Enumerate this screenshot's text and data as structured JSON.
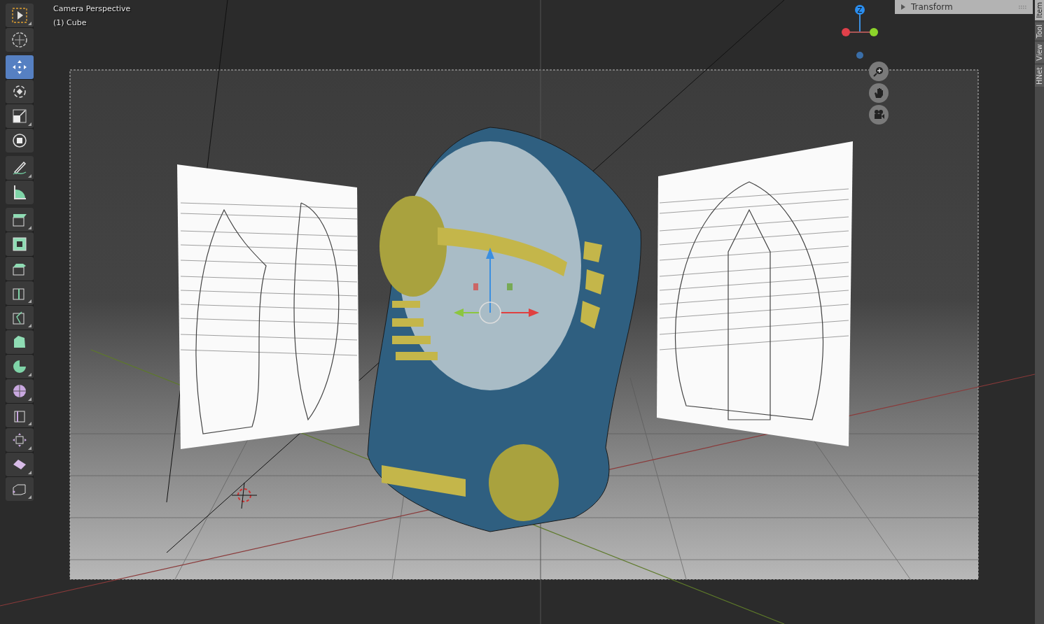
{
  "viewport": {
    "view_name": "Camera Perspective",
    "object_name": "(1) Cube"
  },
  "toolbar": [
    {
      "tools": [
        {
          "kind": "select-box",
          "selected": false,
          "has_submenu": true
        },
        {
          "kind": "cursor",
          "selected": false,
          "has_submenu": false
        }
      ]
    },
    {
      "tools": [
        {
          "kind": "move",
          "selected": true,
          "has_submenu": false
        },
        {
          "kind": "rotate",
          "selected": false,
          "has_submenu": false
        },
        {
          "kind": "scale",
          "selected": false,
          "has_submenu": true
        },
        {
          "kind": "transform",
          "selected": false,
          "has_submenu": false
        }
      ]
    },
    {
      "tools": [
        {
          "kind": "annotate",
          "selected": false,
          "has_submenu": true
        },
        {
          "kind": "measure",
          "selected": false,
          "has_submenu": false
        }
      ]
    },
    {
      "tools": [
        {
          "kind": "extrude",
          "selected": false,
          "has_submenu": true
        },
        {
          "kind": "inset",
          "selected": false,
          "has_submenu": false
        },
        {
          "kind": "bevel",
          "selected": false,
          "has_submenu": false
        },
        {
          "kind": "loop-cut",
          "selected": false,
          "has_submenu": true
        },
        {
          "kind": "knife",
          "selected": false,
          "has_submenu": true
        },
        {
          "kind": "poly-build",
          "selected": false,
          "has_submenu": false
        },
        {
          "kind": "spin",
          "selected": false,
          "has_submenu": true
        },
        {
          "kind": "smooth",
          "selected": false,
          "has_submenu": true
        },
        {
          "kind": "edge-slide",
          "selected": false,
          "has_submenu": true
        },
        {
          "kind": "shrink",
          "selected": false,
          "has_submenu": true
        },
        {
          "kind": "shear",
          "selected": false,
          "has_submenu": true
        },
        {
          "kind": "rip",
          "selected": false,
          "has_submenu": true
        }
      ]
    }
  ],
  "nav_gizmo": {
    "z_label": "Z"
  },
  "sidebar": {
    "panel": {
      "title": "Transform",
      "expanded": false
    },
    "tabs": [
      {
        "label": "Item",
        "selected": true
      },
      {
        "label": "Tool",
        "selected": false
      },
      {
        "label": "View",
        "selected": false
      },
      {
        "label": "HNet",
        "selected": false
      }
    ]
  }
}
